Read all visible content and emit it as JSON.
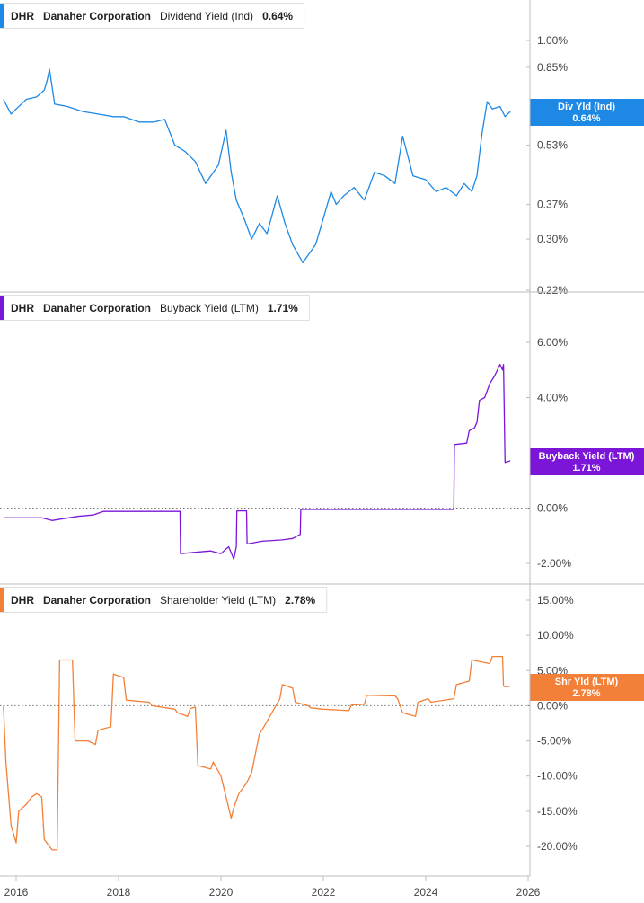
{
  "chart_data": [
    {
      "type": "line",
      "ticker": "DHR",
      "company": "Danaher Corporation",
      "metric": "Dividend Yield (Ind)",
      "current_value": "0.64%",
      "tag_label": "Div Yld (Ind)",
      "tag_value": "0.64%",
      "color": "#1e88e5",
      "scale": "log",
      "ylim": [
        0.22,
        1.17
      ],
      "yticks": [
        0.22,
        0.3,
        0.37,
        0.53,
        0.85,
        1.0
      ],
      "ytick_labels": [
        "0.22%",
        "0.30%",
        "0.37%",
        "0.53%",
        "0.85%",
        "1.00%"
      ],
      "zero_line": false,
      "series": [
        {
          "x": [
            2015.75,
            2015.9,
            2016.0,
            2016.2,
            2016.4,
            2016.55,
            2016.6,
            2016.65,
            2016.75,
            2017.0,
            2017.3,
            2017.6,
            2017.9,
            2018.1,
            2018.4,
            2018.7,
            2018.9,
            2019.1,
            2019.3,
            2019.5,
            2019.7,
            2019.95,
            2020.1,
            2020.2,
            2020.3,
            2020.45,
            2020.6,
            2020.75,
            2020.9,
            2021.1,
            2021.25,
            2021.4,
            2021.6,
            2021.85,
            2022.0,
            2022.15,
            2022.25,
            2022.4,
            2022.6,
            2022.8,
            2023.0,
            2023.2,
            2023.4,
            2023.55,
            2023.75,
            2024.0,
            2024.2,
            2024.4,
            2024.6,
            2024.75,
            2024.9,
            2025.0,
            2025.1,
            2025.2,
            2025.3,
            2025.45,
            2025.55,
            2025.65
          ],
          "y": [
            0.7,
            0.64,
            0.66,
            0.7,
            0.71,
            0.74,
            0.78,
            0.84,
            0.68,
            0.67,
            0.65,
            0.64,
            0.63,
            0.63,
            0.61,
            0.61,
            0.62,
            0.53,
            0.51,
            0.48,
            0.42,
            0.47,
            0.58,
            0.45,
            0.38,
            0.34,
            0.3,
            0.33,
            0.31,
            0.39,
            0.33,
            0.29,
            0.26,
            0.29,
            0.34,
            0.4,
            0.37,
            0.39,
            0.41,
            0.38,
            0.45,
            0.44,
            0.42,
            0.56,
            0.44,
            0.43,
            0.4,
            0.41,
            0.39,
            0.42,
            0.4,
            0.44,
            0.57,
            0.69,
            0.66,
            0.67,
            0.63,
            0.65
          ]
        }
      ]
    },
    {
      "type": "line",
      "ticker": "DHR",
      "company": "Danaher Corporation",
      "metric": "Buyback Yield (LTM)",
      "current_value": "1.71%",
      "tag_label": "Buyback Yield (LTM)",
      "tag_value": "1.71%",
      "color": "#7b16d9",
      "scale": "linear",
      "ylim": [
        -2.5,
        6.5
      ],
      "yticks": [
        -2,
        0,
        2,
        4,
        6
      ],
      "ytick_labels": [
        "-2.00%",
        "0.00%",
        "",
        "4.00%",
        "6.00%"
      ],
      "zero_line": true,
      "series": [
        {
          "x": [
            2015.75,
            2016.5,
            2016.7,
            2017.2,
            2017.5,
            2017.7,
            2018.3,
            2019.0,
            2019.2,
            2019.21,
            2019.5,
            2019.8,
            2020.0,
            2020.15,
            2020.25,
            2020.3,
            2020.31,
            2020.5,
            2020.51,
            2020.8,
            2021.2,
            2021.4,
            2021.55,
            2021.56,
            2022.0,
            2022.5,
            2023.0,
            2023.5,
            2024.0,
            2024.4,
            2024.55,
            2024.56,
            2024.8,
            2024.85,
            2024.95,
            2025.0,
            2025.05,
            2025.15,
            2025.25,
            2025.35,
            2025.45,
            2025.5,
            2025.52,
            2025.55,
            2025.65
          ],
          "y": [
            -0.35,
            -0.35,
            -0.45,
            -0.3,
            -0.25,
            -0.12,
            -0.12,
            -0.12,
            -0.12,
            -1.65,
            -1.6,
            -1.55,
            -1.65,
            -1.4,
            -1.85,
            -1.4,
            -0.1,
            -0.1,
            -1.3,
            -1.2,
            -1.15,
            -1.1,
            -0.95,
            -0.05,
            -0.05,
            -0.05,
            -0.05,
            -0.05,
            -0.05,
            -0.05,
            -0.05,
            2.3,
            2.35,
            2.8,
            2.9,
            3.1,
            3.9,
            4.0,
            4.5,
            4.8,
            5.2,
            5.0,
            5.2,
            1.65,
            1.71
          ]
        }
      ]
    },
    {
      "type": "line",
      "ticker": "DHR",
      "company": "Danaher Corporation",
      "metric": "Shareholder Yield (LTM)",
      "current_value": "2.78%",
      "tag_label": "Shr Yld (LTM)",
      "tag_value": "2.78%",
      "color": "#f28038",
      "scale": "linear",
      "ylim": [
        -21.5,
        17.5
      ],
      "yticks": [
        -20,
        -15,
        -10,
        -5,
        0,
        5,
        10,
        15
      ],
      "ytick_labels": [
        "-20.00%",
        "-15.00%",
        "-10.00%",
        "-5.00%",
        "0.00%",
        "5.00%",
        "10.00%",
        "15.00%"
      ],
      "zero_line": true,
      "series": [
        {
          "x": [
            2015.75,
            2015.8,
            2015.9,
            2016.0,
            2016.05,
            2016.2,
            2016.3,
            2016.4,
            2016.5,
            2016.55,
            2016.7,
            2016.8,
            2016.85,
            2017.1,
            2017.15,
            2017.4,
            2017.55,
            2017.6,
            2017.85,
            2017.9,
            2018.1,
            2018.15,
            2018.6,
            2018.65,
            2019.1,
            2019.15,
            2019.35,
            2019.4,
            2019.5,
            2019.55,
            2019.8,
            2019.85,
            2020.0,
            2020.1,
            2020.2,
            2020.25,
            2020.35,
            2020.5,
            2020.6,
            2020.75,
            2020.8,
            2021.15,
            2021.2,
            2021.4,
            2021.45,
            2021.7,
            2021.75,
            2022.0,
            2022.5,
            2022.55,
            2022.8,
            2022.85,
            2023.4,
            2023.45,
            2023.55,
            2023.8,
            2023.85,
            2024.05,
            2024.1,
            2024.55,
            2024.6,
            2024.85,
            2024.9,
            2025.25,
            2025.3,
            2025.5,
            2025.52,
            2025.55,
            2025.65
          ],
          "y": [
            0.0,
            -8.0,
            -17.0,
            -19.5,
            -15.0,
            -14.0,
            -13.0,
            -12.5,
            -13.0,
            -19.0,
            -20.5,
            -20.5,
            6.5,
            6.5,
            -5.0,
            -5.0,
            -5.5,
            -3.5,
            -3.0,
            4.5,
            4.0,
            0.8,
            0.5,
            0.0,
            -0.5,
            -1.0,
            -1.5,
            -0.4,
            -0.2,
            -8.5,
            -9.0,
            -8.0,
            -10.0,
            -13.0,
            -16.0,
            -14.5,
            -12.5,
            -11.0,
            -9.5,
            -4.0,
            -3.5,
            1.0,
            3.0,
            2.5,
            0.5,
            0.0,
            -0.3,
            -0.5,
            -0.7,
            0.1,
            0.2,
            1.5,
            1.4,
            1.0,
            -1.0,
            -1.5,
            0.5,
            1.0,
            0.5,
            1.0,
            3.0,
            3.5,
            6.5,
            6.0,
            7.0,
            7.0,
            2.8,
            2.7,
            2.78
          ]
        }
      ]
    }
  ],
  "x_axis": {
    "ticks": [
      2016,
      2018,
      2020,
      2022,
      2024,
      2026
    ],
    "tick_labels": [
      "2016",
      "2018",
      "2020",
      "2022",
      "2024",
      "2026"
    ],
    "xlim": [
      2015.75,
      2026.6
    ]
  },
  "theme": {
    "grid_color": "#d9d9d9",
    "axis_color": "#bdbdbd",
    "zero_line_color": "#777777"
  }
}
